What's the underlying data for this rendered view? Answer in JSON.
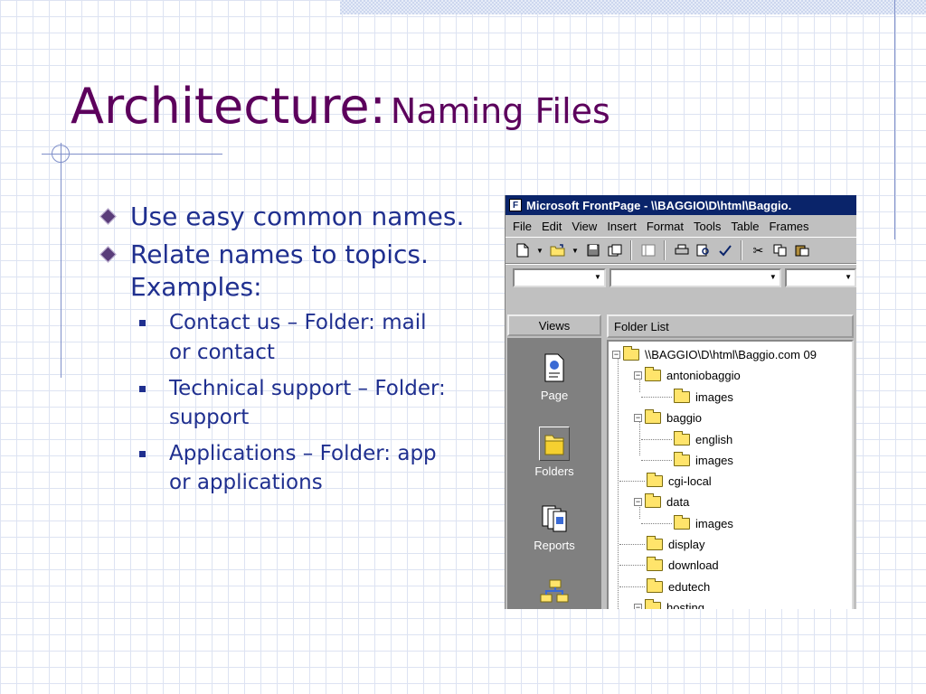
{
  "slide": {
    "title_main": "Architecture:",
    "title_sub": "Naming Files",
    "bullets": [
      {
        "text": "Use easy common names."
      },
      {
        "text": "Relate names to topics. Examples:"
      }
    ],
    "sub_bullets": [
      {
        "text": "Contact us – Folder: mail or contact"
      },
      {
        "text": "Technical support – Folder: support"
      },
      {
        "text": "Applications – Folder: app or applications"
      }
    ]
  },
  "window": {
    "title": "Microsoft FrontPage - \\\\BAGGIO\\D\\html\\Baggio.",
    "menu": [
      "File",
      "Edit",
      "View",
      "Insert",
      "Format",
      "Tools",
      "Table",
      "Frames"
    ],
    "views_header": "Views",
    "views": [
      "Page",
      "Folders",
      "Reports"
    ],
    "folder_list_header": "Folder List",
    "tree": [
      {
        "label": "\\\\BAGGIO\\D\\html\\Baggio.com 09",
        "level": 0,
        "toggle": "minus"
      },
      {
        "label": "antoniobaggio",
        "level": 1,
        "toggle": "minus"
      },
      {
        "label": "images",
        "level": 2,
        "toggle": "none"
      },
      {
        "label": "baggio",
        "level": 1,
        "toggle": "minus"
      },
      {
        "label": "english",
        "level": 2,
        "toggle": "none"
      },
      {
        "label": "images",
        "level": 2,
        "toggle": "none"
      },
      {
        "label": "cgi-local",
        "level": 1,
        "toggle": "none"
      },
      {
        "label": "data",
        "level": 1,
        "toggle": "minus"
      },
      {
        "label": "images",
        "level": 2,
        "toggle": "none"
      },
      {
        "label": "display",
        "level": 1,
        "toggle": "none"
      },
      {
        "label": "download",
        "level": 1,
        "toggle": "none"
      },
      {
        "label": "edutech",
        "level": 1,
        "toggle": "none"
      },
      {
        "label": "hosting",
        "level": 1,
        "toggle": "minus"
      }
    ]
  },
  "colors": {
    "title": "#5c005c",
    "body_text": "#1f2f8f",
    "titlebar": "#0a246a",
    "folder": "#ffe46b"
  }
}
